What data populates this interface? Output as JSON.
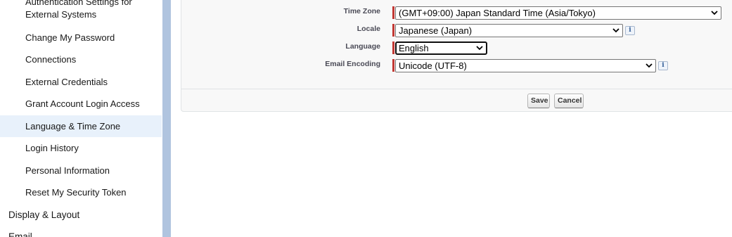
{
  "sidebar": {
    "items": [
      {
        "label": "Authentication Settings for External Systems"
      },
      {
        "label": "Change My Password"
      },
      {
        "label": "Connections"
      },
      {
        "label": "External Credentials"
      },
      {
        "label": "Grant Account Login Access"
      },
      {
        "label": "Language & Time Zone"
      },
      {
        "label": "Login History"
      },
      {
        "label": "Personal Information"
      },
      {
        "label": "Reset My Security Token"
      }
    ],
    "sections": [
      {
        "label": "Display & Layout"
      },
      {
        "label": "Email"
      }
    ]
  },
  "form": {
    "time_zone": {
      "label": "Time Zone",
      "value": "(GMT+09:00) Japan Standard Time (Asia/Tokyo)"
    },
    "locale": {
      "label": "Locale",
      "value": "Japanese (Japan)",
      "info": "i"
    },
    "language": {
      "label": "Language",
      "value": "English"
    },
    "email_encoding": {
      "label": "Email Encoding",
      "value": "Unicode (UTF-8)",
      "info": "i"
    }
  },
  "buttons": {
    "save": "Save",
    "cancel": "Cancel"
  },
  "colors": {
    "required": "#c23934",
    "active_nav": "#e8f1fb",
    "divider": "#b0c4df"
  }
}
